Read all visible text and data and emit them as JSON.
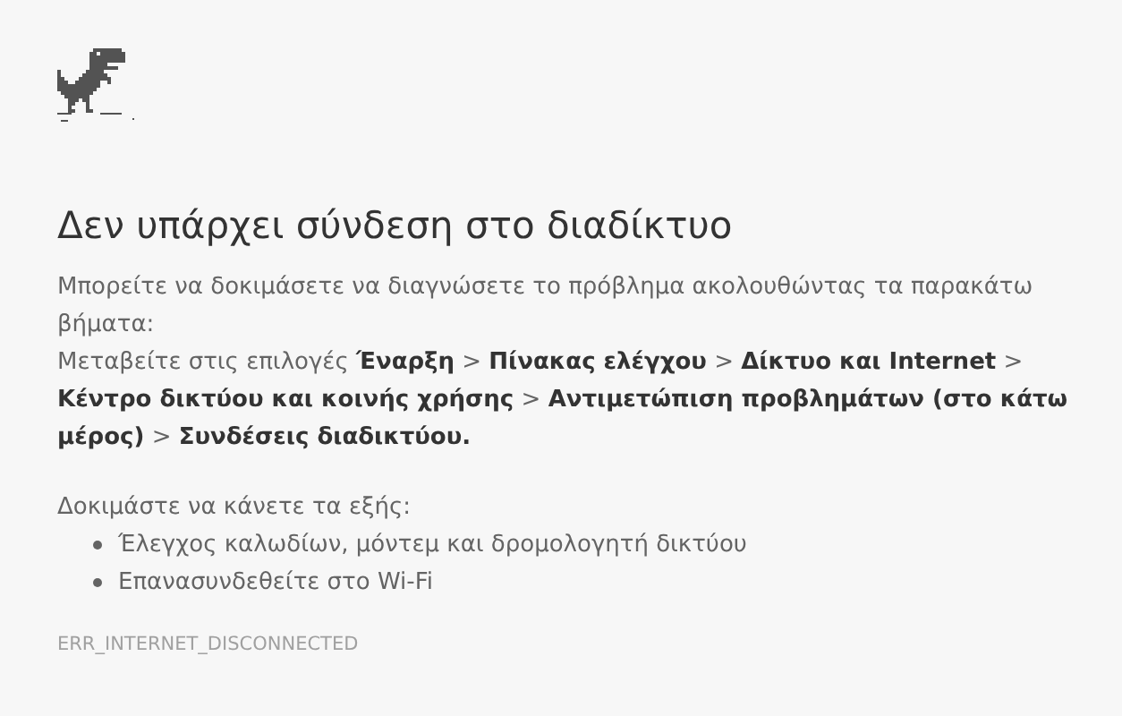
{
  "heading": "Δεν υπάρχει σύνδεση στο διαδίκτυο",
  "intro": "Μπορείτε να δοκιμάσετε να διαγνώσετε το πρόβλημα ακολουθώντας τα παρακάτω βήματα:",
  "instructions": "Μεταβείτε στις επιλογές **Έναρξη** > **Πίνακας ελέγχου** > **Δίκτυο και Internet** > **Κέντρο δικτύου και κοινής χρήσης** > **Αντιμετώπιση προβλημάτων (στο κάτω μέρος)** > **Συνδέσεις διαδικτύου.**",
  "suggestions_title": "Δοκιμάστε να κάνετε τα εξής:",
  "suggestions": [
    "Έλεγχος καλωδίων, μόντεμ και δρομολογητή δικτύου",
    "Επανασυνδεθείτε στο Wi-Fi"
  ],
  "error_code": "ERR_INTERNET_DISCONNECTED"
}
